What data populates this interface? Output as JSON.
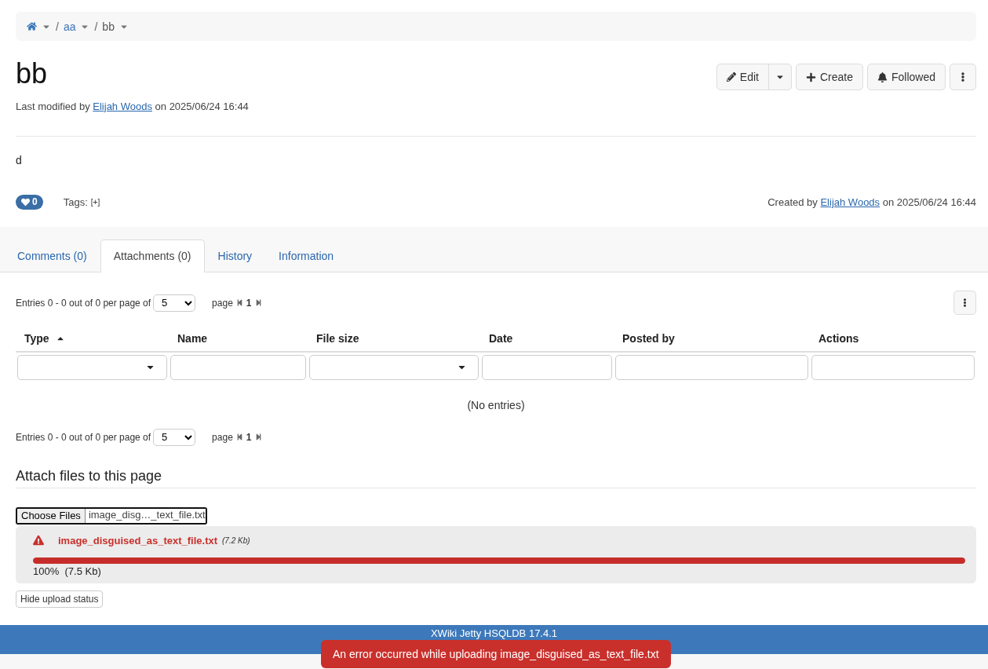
{
  "breadcrumb": [
    {
      "kind": "home"
    },
    {
      "kind": "page",
      "separator": "/",
      "label": "aa"
    },
    {
      "kind": "page",
      "separator": "/",
      "label": "bb"
    }
  ],
  "page": {
    "title": "bb",
    "modified": {
      "prefix": "Last modified by",
      "author": "Elijah Woods",
      "suffix": "on 2025/06/24 16:44"
    }
  },
  "actions": [
    {
      "kind": "split",
      "label": "Edit"
    },
    {
      "kind": "create",
      "label": "Create"
    },
    {
      "kind": "follow",
      "label": "Followed"
    },
    {
      "kind": "more"
    }
  ],
  "content": "d",
  "likes": "0",
  "tags": {
    "label": "Tags:",
    "add": "[+]"
  },
  "created": {
    "prefix": "Created by",
    "author": "Elijah Woods",
    "suffix": "on 2025/06/24 16:44"
  },
  "tabs": [
    {
      "label": "Comments (0)",
      "selected": false
    },
    {
      "label": "Attachments (0)",
      "selected": true
    },
    {
      "label": "History",
      "selected": false
    },
    {
      "label": "Information",
      "selected": false
    }
  ],
  "pagination_top": {
    "text": "Entries 0 - 0 out of 0 per page of",
    "per_page": "5",
    "page_label": "page",
    "page": "1"
  },
  "table": {
    "columns": [
      {
        "label": "Type",
        "sorted": true
      },
      {
        "label": "Name",
        "sorted": false
      },
      {
        "label": "File size",
        "sorted": false
      },
      {
        "label": "Date",
        "sorted": false
      },
      {
        "label": "Posted by",
        "sorted": false
      },
      {
        "label": "Actions",
        "sorted": false
      }
    ],
    "filters": [
      {
        "kind": "select"
      },
      {
        "kind": "text"
      },
      {
        "kind": "select"
      },
      {
        "kind": "text"
      },
      {
        "kind": "text"
      },
      {
        "kind": "text"
      }
    ],
    "empty": "(No entries)"
  },
  "pagination_bottom": {
    "text": "Entries 0 - 0 out of 0 per page of",
    "per_page": "5",
    "page_label": "page",
    "page": "1"
  },
  "attach": {
    "heading": "Attach files to this page",
    "choose": "Choose Files",
    "filename": "image_disg…_text_file.txt"
  },
  "upload": {
    "error": true,
    "name": "image_disguised_as_text_file.txt",
    "size": "(7.2 Kb)",
    "level": 1,
    "percent": "100%",
    "transferred": "(7.5 Kb)"
  },
  "hide_button": "Hide upload status",
  "footer": "XWiki Jetty HSQLDB 17.4.1",
  "toast": "An error occurred while uploading image_disguised_as_text_file.txt"
}
